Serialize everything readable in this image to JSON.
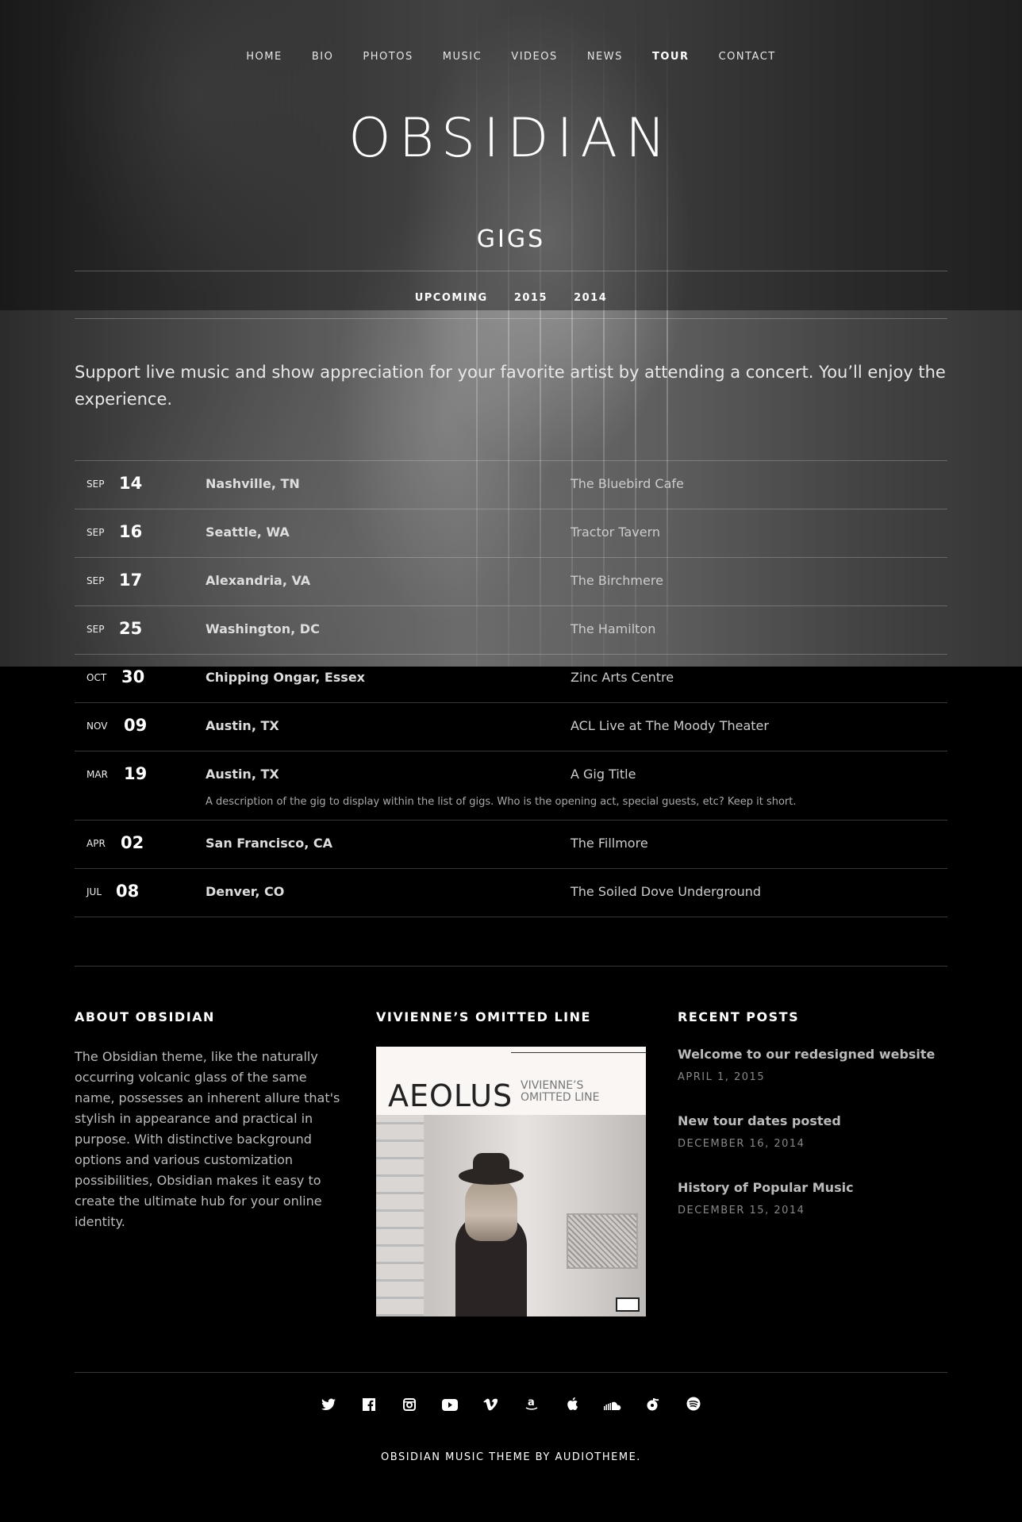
{
  "nav": {
    "items": [
      {
        "label": "HOME"
      },
      {
        "label": "BIO"
      },
      {
        "label": "PHOTOS"
      },
      {
        "label": "MUSIC"
      },
      {
        "label": "VIDEOS"
      },
      {
        "label": "NEWS"
      },
      {
        "label": "TOUR",
        "active": true
      },
      {
        "label": "CONTACT"
      }
    ]
  },
  "site_title": "OBSIDIAN",
  "page_title": "GIGS",
  "tabs": [
    "UPCOMING",
    "2015",
    "2014"
  ],
  "intro": "Support live music and show appreciation for your favorite artist by attending a concert. You’ll enjoy the experience.",
  "gigs": [
    {
      "month": "SEP",
      "day": "14",
      "city": "Nashville, TN",
      "venue": "The Bluebird Cafe"
    },
    {
      "month": "SEP",
      "day": "16",
      "city": "Seattle, WA",
      "venue": "Tractor Tavern"
    },
    {
      "month": "SEP",
      "day": "17",
      "city": "Alexandria, VA",
      "venue": "The Birchmere"
    },
    {
      "month": "SEP",
      "day": "25",
      "city": "Washington, DC",
      "venue": "The Hamilton"
    },
    {
      "month": "OCT",
      "day": "30",
      "city": "Chipping Ongar, Essex",
      "venue": "Zinc Arts Centre"
    },
    {
      "month": "NOV",
      "day": "09",
      "city": "Austin, TX",
      "venue": "ACL Live at The Moody Theater"
    },
    {
      "month": "MAR",
      "day": "19",
      "city": "Austin, TX",
      "venue": "A Gig Title",
      "description": "A description of the gig to display within the list of gigs. Who is the opening act, special guests, etc? Keep it short."
    },
    {
      "month": "APR",
      "day": "02",
      "city": "San Francisco, CA",
      "venue": "The Fillmore"
    },
    {
      "month": "JUL",
      "day": "08",
      "city": "Denver, CO",
      "venue": "The Soiled Dove Underground"
    }
  ],
  "widgets": {
    "about": {
      "title": "ABOUT OBSIDIAN",
      "text": "The Obsidian theme, like the naturally occurring volcanic glass of the same name, possesses an inherent allure that's stylish in appearance and practical in purpose. With distinctive background options and various customization possibilities, Obsidian makes it easy to create the ultimate hub for your online identity."
    },
    "album": {
      "title": "VIVIENNE’S OMITTED LINE",
      "cover_word": "AEOLUS",
      "cover_sub_1": "VIVIENNE’S",
      "cover_sub_2": "OMITTED LINE"
    },
    "recent": {
      "title": "RECENT POSTS",
      "posts": [
        {
          "title": "Welcome to our redesigned website",
          "date": "APRIL 1, 2015"
        },
        {
          "title": "New tour dates posted",
          "date": "DECEMBER 16, 2014"
        },
        {
          "title": "History of Popular Music",
          "date": "DECEMBER 15, 2014"
        }
      ]
    }
  },
  "social_icons": [
    "twitter-icon",
    "facebook-icon",
    "instagram-icon",
    "youtube-icon",
    "vimeo-icon",
    "amazon-icon",
    "apple-icon",
    "soundcloud-icon",
    "rdio-icon",
    "spotify-icon"
  ],
  "credit": "OBSIDIAN MUSIC THEME BY AUDIOTHEME."
}
